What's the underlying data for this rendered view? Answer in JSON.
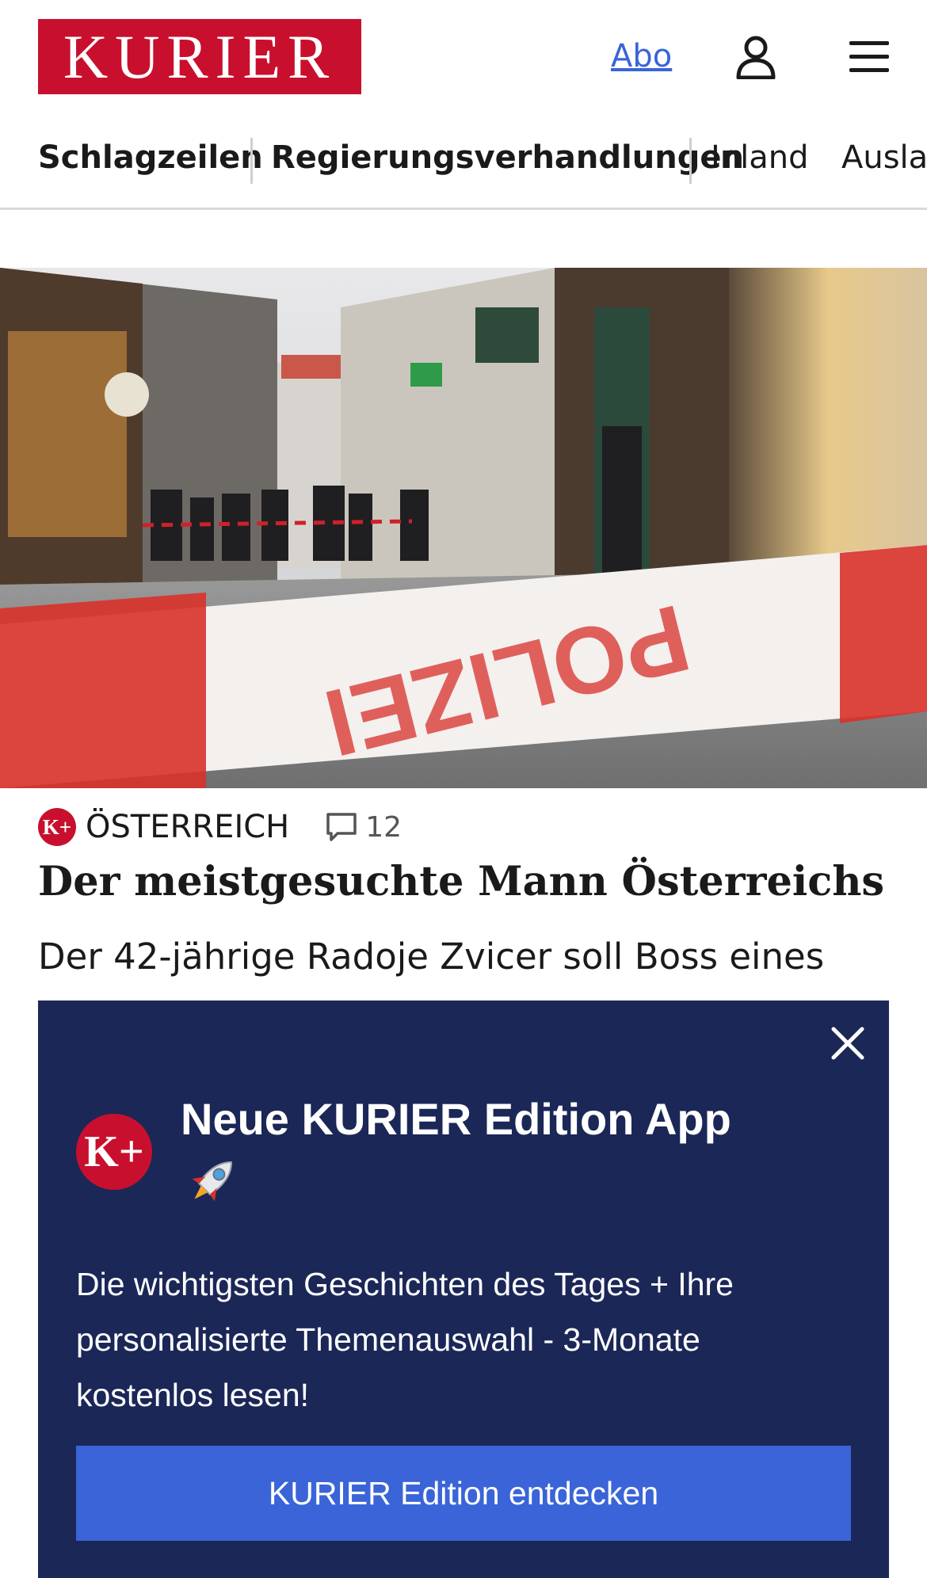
{
  "header": {
    "logo_text": "KURIER",
    "abo_label": "Abo",
    "user_icon": "user-icon",
    "menu_icon": "hamburger-menu-icon"
  },
  "nav": {
    "items": [
      {
        "label": "Schlagzeilen"
      },
      {
        "label": "Regierungsverhandlungen"
      },
      {
        "label": "Inland"
      },
      {
        "label": "Ausland"
      }
    ]
  },
  "article": {
    "badge": "K+",
    "section": "ÖSTERREICH",
    "comment_count": "12",
    "headline": "Der meistgesuchte Mann Österreichs",
    "teaser": "Der 42-jährige Radoje Zvicer soll Boss eines"
  },
  "overlay": {
    "badge": "K+",
    "title": "Neue KURIER Edition App",
    "body": "Die wichtigsten Geschichten des Tages + Ihre personalisierte Themenauswahl - 3-Monate kostenlos lesen!",
    "cta_label": "KURIER Edition entdecken"
  },
  "colors": {
    "brand_red": "#c8102e",
    "overlay_bg": "#1b2757",
    "cta_blue": "#3a64d8",
    "link_blue": "#3a64d8"
  }
}
